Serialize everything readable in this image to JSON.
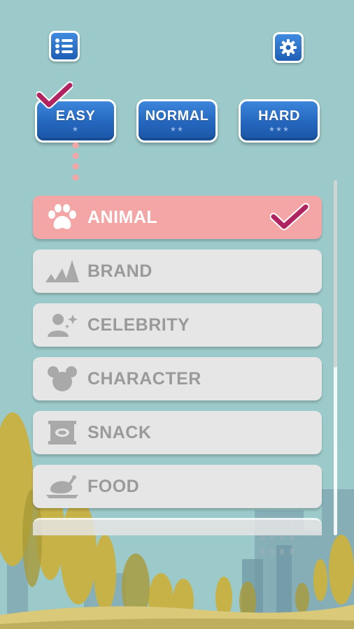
{
  "toolbar": {
    "list_icon": "list-icon",
    "settings_icon": "gear-icon"
  },
  "difficulty": {
    "selected": "EASY",
    "levels": [
      {
        "label": "EASY",
        "stars": "★"
      },
      {
        "label": "NORMAL",
        "stars": "★★"
      },
      {
        "label": "HARD",
        "stars": "★★★"
      }
    ]
  },
  "categories": [
    {
      "label": "ANIMAL",
      "icon": "paw-icon",
      "selected": true
    },
    {
      "label": "BRAND",
      "icon": "stripes-icon",
      "selected": false
    },
    {
      "label": "CELEBRITY",
      "icon": "person-sparkle-icon",
      "selected": false
    },
    {
      "label": "CHARACTER",
      "icon": "mouse-head-icon",
      "selected": false
    },
    {
      "label": "SNACK",
      "icon": "snack-package-icon",
      "selected": false
    },
    {
      "label": "FOOD",
      "icon": "roast-chicken-icon",
      "selected": false
    }
  ],
  "colors": {
    "background": "#9cc9c9",
    "button_blue": "#2466bd",
    "selected_row": "#f4a6a6",
    "row": "#e6e6e6",
    "check": "#b0245f"
  }
}
